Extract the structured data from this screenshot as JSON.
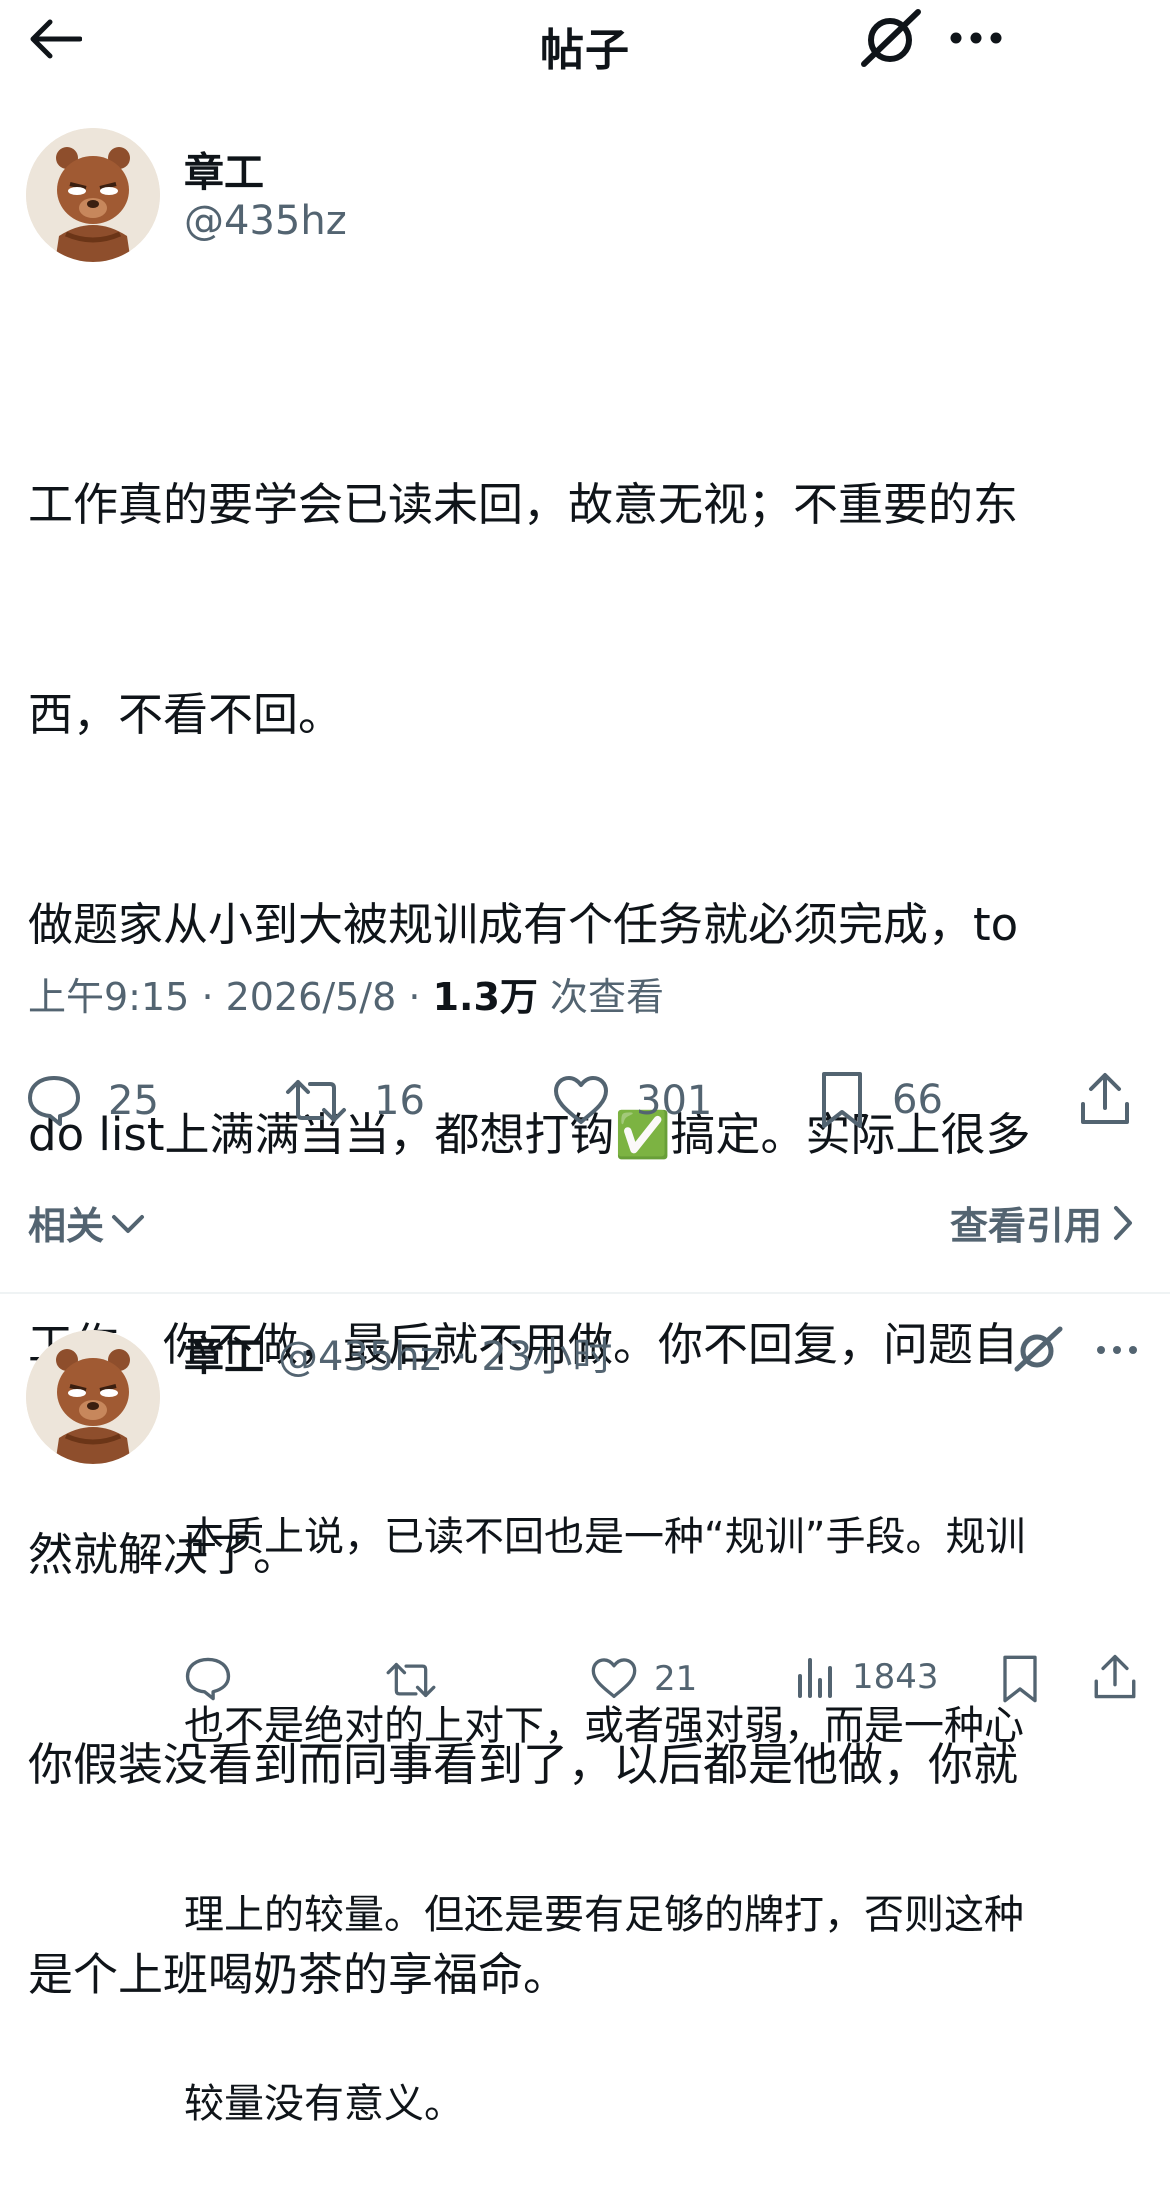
{
  "header": {
    "title": "帖子"
  },
  "post": {
    "author_name": "章工",
    "author_handle": "@435hz",
    "body_lines": [
      "工作真的要学会已读未回，故意无视；不重要的东",
      "西，不看不回。",
      "做题家从小到大被规训成有个任务就必须完成，to",
      "do list上满满当当，都想打钩✅搞定。实际上很多",
      "工作，你不做，最后就不用做。你不回复，问题自",
      "然就解决了。",
      "你假装没看到而同事看到了，以后都是他做，你就",
      "是个上班喝奶茶的享福命。"
    ],
    "time": "上午9:15",
    "date": "2026/5/8",
    "views_count": "1.3万",
    "views_label": "次查看",
    "separator": "·",
    "actions": {
      "reply": "25",
      "repost": "16",
      "like": "301",
      "bookmark": "66"
    }
  },
  "related": {
    "label": "相关"
  },
  "view_quotes": {
    "label": "查看引用"
  },
  "reply": {
    "author_name": "章工",
    "author_handle": "@435hz",
    "separator": "·",
    "time_ago": "23小时",
    "body_lines": [
      "本质上说，已读不回也是一种“规训”手段。规训",
      "也不是绝对的上对下，或者强对弱，而是一种心",
      "理上的较量。但还是要有足够的牌打，否则这种",
      "较量没有意义。"
    ],
    "actions": {
      "like": "21",
      "views": "1843"
    }
  },
  "icons": [
    "back-arrow-icon",
    "grok-icon",
    "more-icon",
    "reply-icon",
    "repost-icon",
    "like-icon",
    "bookmark-icon",
    "share-icon",
    "views-icon",
    "chevron-down-icon",
    "chevron-right-icon"
  ],
  "colors": {
    "text": "#0f1419",
    "secondary": "#536471",
    "divider": "#eff3f4"
  }
}
